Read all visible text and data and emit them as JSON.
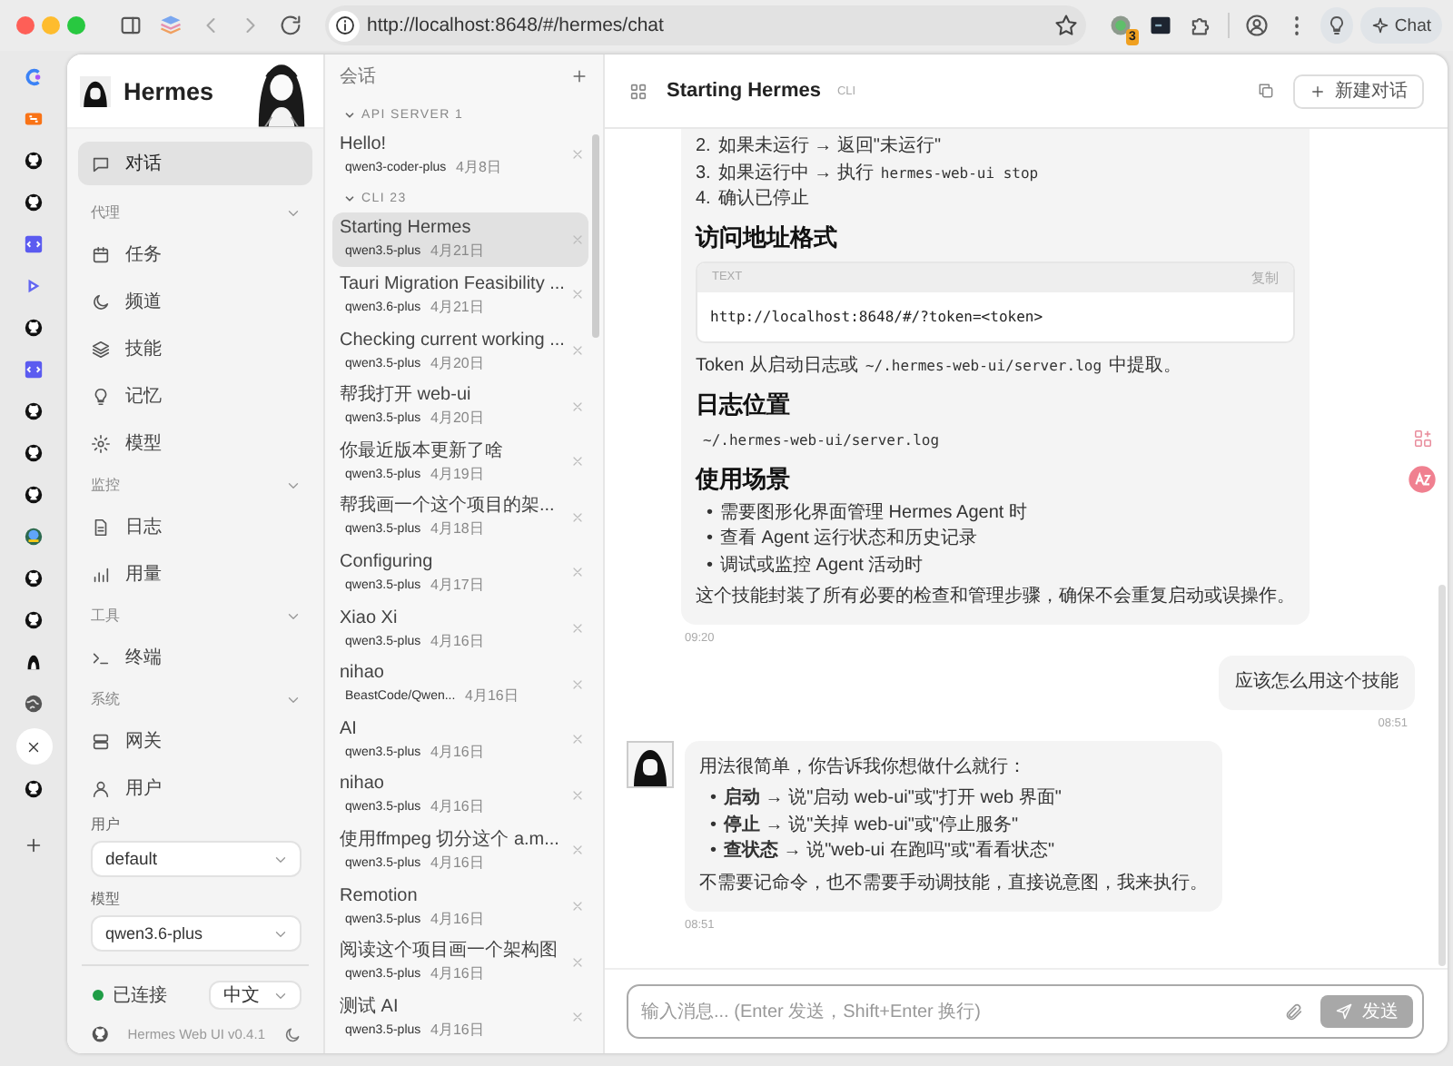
{
  "browser": {
    "url": "http://localhost:8648/#/hermes/chat",
    "extension_badge": "3",
    "chat_button": "Chat"
  },
  "sidebar": {
    "title": "Hermes",
    "nav": [
      {
        "label": "对话",
        "selected": true
      }
    ],
    "sections": [
      {
        "title": "代理",
        "expanded": true,
        "items": [
          {
            "label": "任务",
            "selected": false
          },
          {
            "label": "频道",
            "selected": false
          },
          {
            "label": "技能",
            "selected": false
          },
          {
            "label": "记忆",
            "selected": false
          },
          {
            "label": "模型",
            "selected": false
          }
        ]
      },
      {
        "title": "监控",
        "expanded": true,
        "items": [
          {
            "label": "日志",
            "selected": false
          },
          {
            "label": "用量",
            "selected": false
          }
        ]
      },
      {
        "title": "工具",
        "expanded": true,
        "items": [
          {
            "label": "终端",
            "selected": false
          }
        ]
      },
      {
        "title": "系统",
        "expanded": true,
        "items": [
          {
            "label": "网关",
            "selected": false
          },
          {
            "label": "用户",
            "selected": false
          }
        ]
      }
    ],
    "user_label": "用户",
    "user_value": "default",
    "model_label": "模型",
    "model_value": "qwen3.6-plus",
    "status": {
      "label": "已连接",
      "connected": true
    },
    "language": "中文",
    "version": "Hermes Web UI v0.4.1"
  },
  "sessions": {
    "title": "会话",
    "groups": [
      {
        "title": "API SERVER 1",
        "expanded": true,
        "items": [
          {
            "title": "Hello!",
            "model": "qwen3-coder-plus",
            "date": "4月8日",
            "selected": false
          }
        ]
      },
      {
        "title": "CLI 23",
        "expanded": true,
        "items": [
          {
            "title": "Starting Hermes",
            "model": "qwen3.5-plus",
            "date": "4月21日",
            "selected": true
          },
          {
            "title": "Tauri Migration Feasibility ...",
            "model": "qwen3.6-plus",
            "date": "4月21日",
            "selected": false
          },
          {
            "title": "Checking current working ...",
            "model": "qwen3.5-plus",
            "date": "4月20日",
            "selected": false
          },
          {
            "title": "帮我打开 web-ui",
            "model": "qwen3.5-plus",
            "date": "4月20日",
            "selected": false
          },
          {
            "title": "你最近版本更新了啥",
            "model": "qwen3.5-plus",
            "date": "4月19日",
            "selected": false
          },
          {
            "title": "帮我画一个这个项目的架...",
            "model": "qwen3.5-plus",
            "date": "4月18日",
            "selected": false
          },
          {
            "title": "Configuring",
            "model": "qwen3.5-plus",
            "date": "4月17日",
            "selected": false
          },
          {
            "title": "Xiao Xi",
            "model": "qwen3.5-plus",
            "date": "4月16日",
            "selected": false
          },
          {
            "title": "nihao",
            "model": "BeastCode/Qwen...",
            "date": "4月16日",
            "selected": false
          },
          {
            "title": "AI",
            "model": "qwen3.5-plus",
            "date": "4月16日",
            "selected": false
          },
          {
            "title": "nihao",
            "model": "qwen3.5-plus",
            "date": "4月16日",
            "selected": false
          },
          {
            "title": "使用ffmpeg 切分这个 a.m...",
            "model": "qwen3.5-plus",
            "date": "4月16日",
            "selected": false
          },
          {
            "title": "Remotion",
            "model": "qwen3.5-plus",
            "date": "4月16日",
            "selected": false
          },
          {
            "title": "阅读这个项目画一个架构图",
            "model": "qwen3.5-plus",
            "date": "4月16日",
            "selected": false
          },
          {
            "title": "测试 AI",
            "model": "qwen3.5-plus",
            "date": "4月16日",
            "selected": false
          }
        ]
      }
    ]
  },
  "chat": {
    "title": "Starting Hermes",
    "source": "CLI",
    "new_button": "新建对话",
    "messages": [
      {
        "kind": "assistant",
        "avatar": false,
        "time": "09:20",
        "blocks": [
          {
            "kind": "ol",
            "items": [
              {
                "marker": "2.",
                "parts": [
                  {
                    "kind": "text",
                    "text": "如果未运行 → 返回\"未运行\""
                  }
                ]
              },
              {
                "marker": "3.",
                "parts": [
                  {
                    "kind": "text",
                    "text": "如果运行中 → 执行"
                  },
                  {
                    "kind": "code",
                    "text": "hermes-web-ui stop"
                  }
                ]
              },
              {
                "marker": "4.",
                "parts": [
                  {
                    "kind": "text",
                    "text": "确认已停止"
                  }
                ]
              }
            ]
          },
          {
            "kind": "heading",
            "text": "访问地址格式"
          },
          {
            "kind": "code",
            "language": "TEXT",
            "copy": "复制",
            "text": "http://localhost:8648/#/?token=<token>"
          },
          {
            "kind": "p",
            "parts": [
              {
                "kind": "text",
                "text": "Token 从启动日志或"
              },
              {
                "kind": "code",
                "text": "~/.hermes-web-ui/server.log"
              },
              {
                "kind": "text",
                "text": "中提取。"
              }
            ]
          },
          {
            "kind": "heading",
            "text": "日志位置"
          },
          {
            "kind": "p",
            "parts": [
              {
                "kind": "code",
                "text": "~/.hermes-web-ui/server.log"
              }
            ]
          },
          {
            "kind": "heading",
            "text": "使用场景"
          },
          {
            "kind": "ul",
            "items": [
              {
                "marker": "•",
                "parts": [
                  {
                    "kind": "text",
                    "text": "需要图形化界面管理 Hermes Agent 时"
                  }
                ]
              },
              {
                "marker": "•",
                "parts": [
                  {
                    "kind": "text",
                    "text": "查看 Agent 运行状态和历史记录"
                  }
                ]
              },
              {
                "marker": "•",
                "parts": [
                  {
                    "kind": "text",
                    "text": "调试或监控 Agent 活动时"
                  }
                ]
              }
            ]
          },
          {
            "kind": "p",
            "parts": [
              {
                "kind": "text",
                "text": "这个技能封装了所有必要的检查和管理步骤，确保不会重复启动或误操作。"
              }
            ]
          }
        ]
      },
      {
        "kind": "user",
        "avatar": false,
        "time": "08:51",
        "blocks": [
          {
            "kind": "p",
            "parts": [
              {
                "kind": "text",
                "text": "应该怎么用这个技能"
              }
            ]
          }
        ]
      },
      {
        "kind": "assistant",
        "avatar": true,
        "time": "08:51",
        "blocks": [
          {
            "kind": "p",
            "parts": [
              {
                "kind": "text",
                "text": "用法很简单，你告诉我你想做什么就行："
              }
            ]
          },
          {
            "kind": "ul",
            "items": [
              {
                "marker": "•",
                "parts": [
                  {
                    "kind": "text",
                    "text": "**启动** → 说\"启动 web-ui\"或\"打开 web 界面\""
                  }
                ]
              },
              {
                "marker": "•",
                "parts": [
                  {
                    "kind": "text",
                    "text": "**停止** → 说\"关掉 web-ui\"或\"停止服务\""
                  }
                ]
              },
              {
                "marker": "•",
                "parts": [
                  {
                    "kind": "text",
                    "text": "**查状态** → 说\"web-ui 在跑吗\"或\"看看状态\""
                  }
                ]
              }
            ]
          },
          {
            "kind": "p",
            "parts": [
              {
                "kind": "text",
                "text": "不需要记命令，也不需要手动调技能，直接说意图，我来执行。"
              }
            ]
          }
        ]
      }
    ],
    "input": {
      "placeholder": "输入消息... (Enter 发送，Shift+Enter 换行)",
      "send_label": "发送",
      "send_disabled": true
    }
  }
}
